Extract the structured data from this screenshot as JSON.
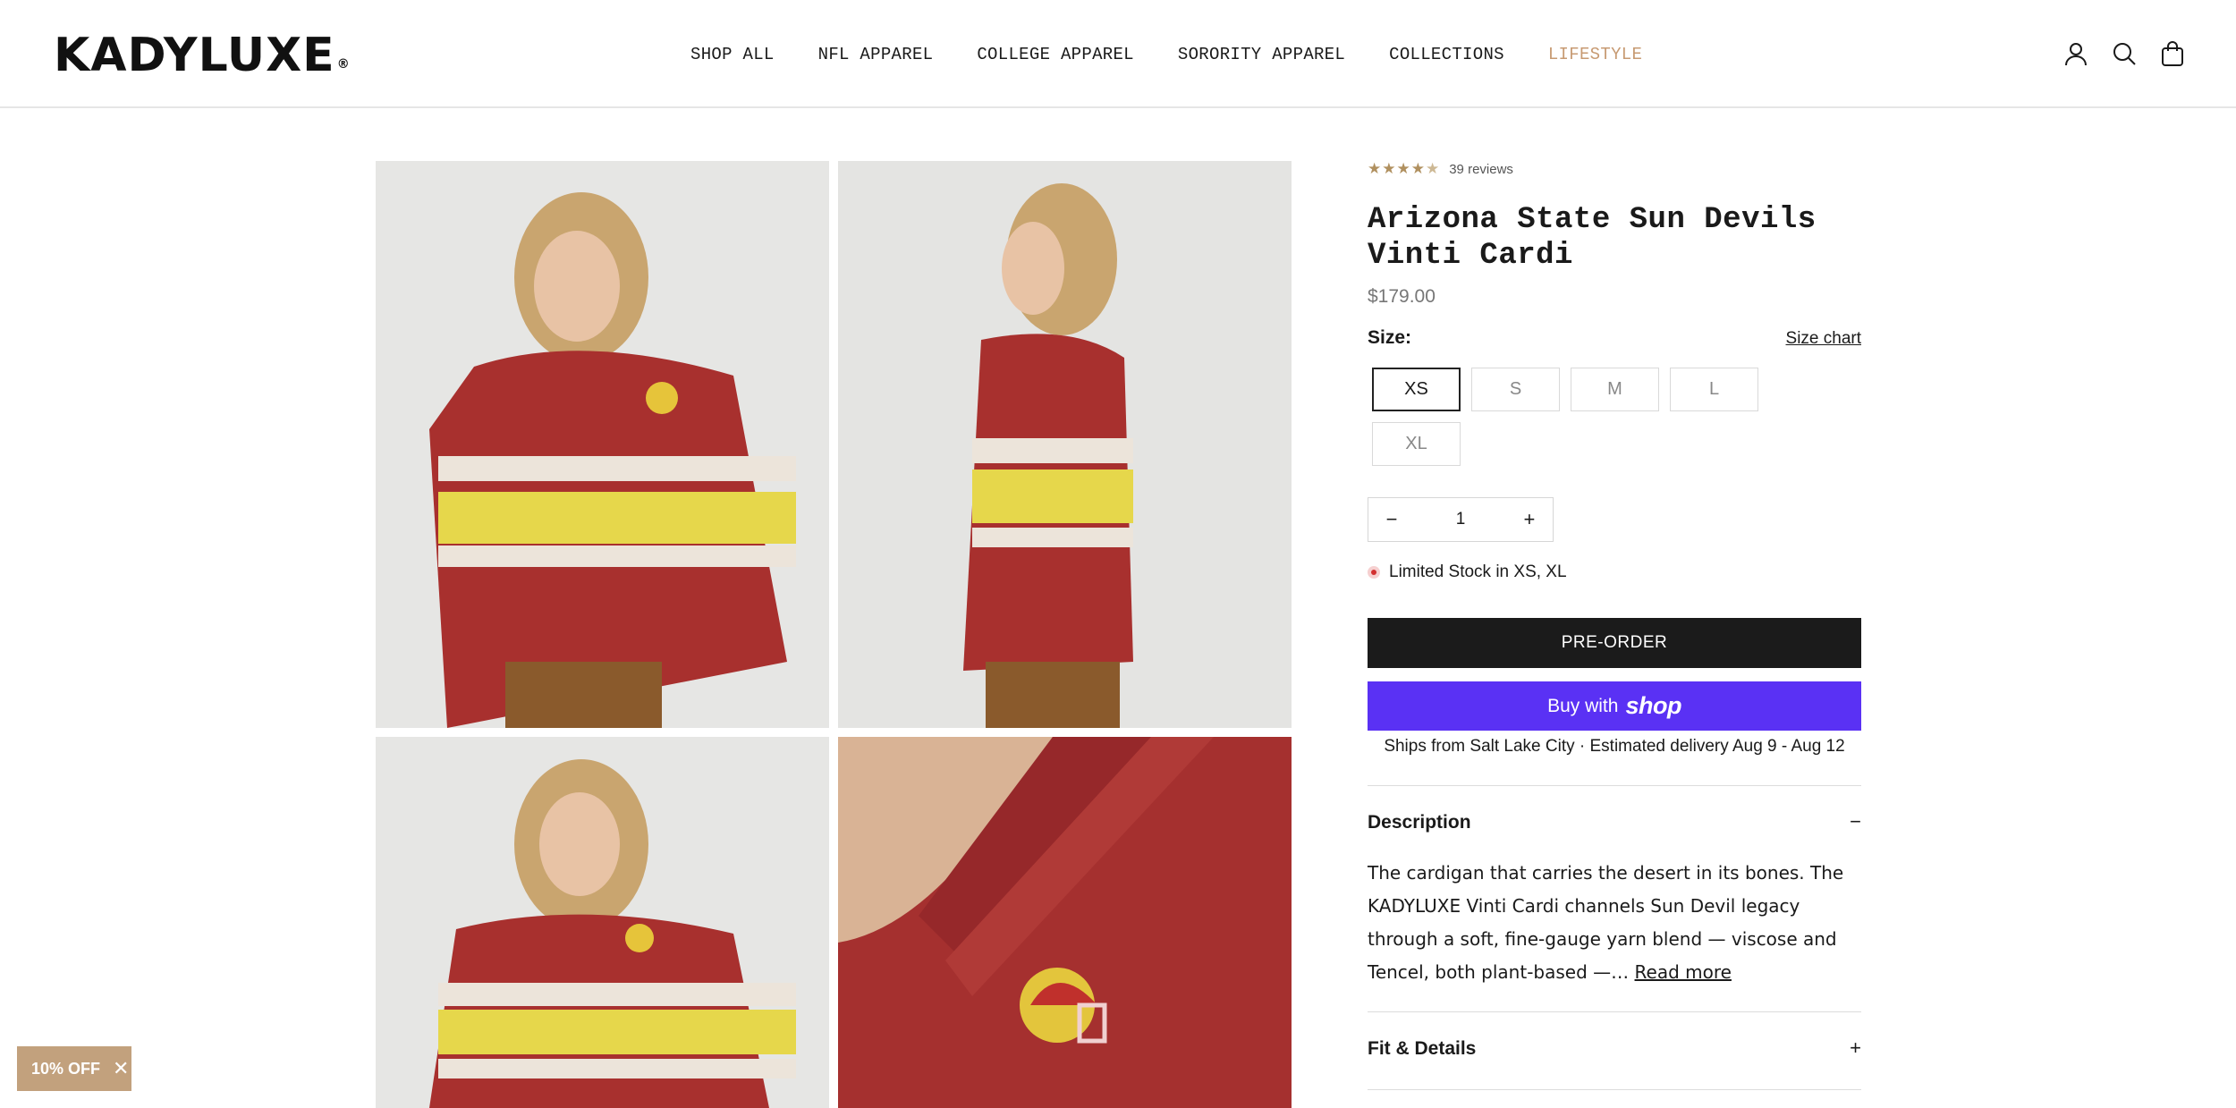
{
  "header": {
    "logo": "KADYLUXE",
    "logo_mark": "®",
    "nav": [
      {
        "label": "SHOP ALL"
      },
      {
        "label": "NFL APPAREL"
      },
      {
        "label": "COLLEGE APPAREL"
      },
      {
        "label": "SORORITY APPAREL"
      },
      {
        "label": "COLLECTIONS"
      },
      {
        "label": "LIFESTYLE",
        "accent": true
      }
    ],
    "accent_color": "#c79a72",
    "icons": [
      "account-icon",
      "search-icon",
      "cart-bag-icon"
    ]
  },
  "product": {
    "rating_stars": "★★★★",
    "rating_half": "★",
    "rating_value": 4.5,
    "review_count": "39 reviews",
    "title": "Arizona State Sun Devils Vinti Cardi",
    "price": "$179.00",
    "size_label": "Size:",
    "size_chart": "Size chart",
    "sizes": [
      "XS",
      "S",
      "M",
      "L",
      "XL"
    ],
    "selected_size": "XS",
    "qty_minus": "−",
    "qty_plus": "+",
    "quantity": "1",
    "stock_text": "Limited Stock in XS, XL",
    "stock_color": "#d23030",
    "preorder_label": "PRE-ORDER",
    "shoppay_prefix": "Buy with",
    "shoppay_brand": "shop",
    "shoppay_color": "#5a31f4",
    "shipping": "Ships from Salt Lake City · Estimated delivery Aug 9 - Aug 12",
    "description_title": "Description",
    "description_toggle": "−",
    "description_text": "The cardigan that carries the desert in its bones. The KADYLUXE Vinti Cardi channels Sun Devil legacy through a soft, fine-gauge yarn blend — viscose and Tencel, both plant-based —…",
    "read_more": "Read more",
    "fit_title": "Fit & Details",
    "fit_toggle": "+"
  },
  "promo": {
    "label": "10% OFF",
    "close": "✕",
    "color": "#c2a17d"
  }
}
